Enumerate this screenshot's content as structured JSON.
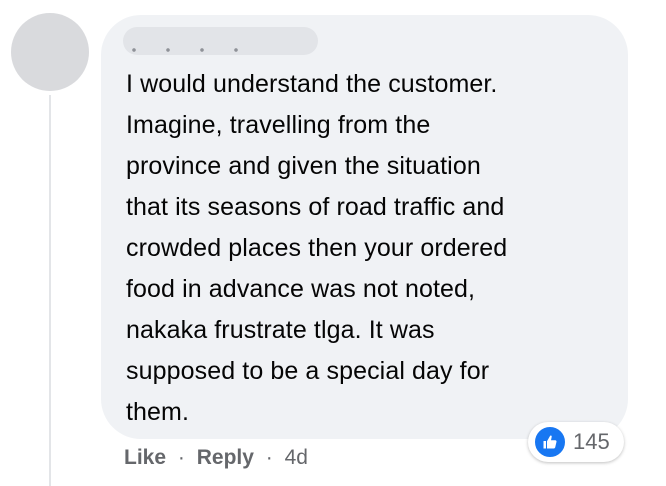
{
  "comment": {
    "author_redacted": true,
    "text_lines": [
      "I would understand the customer.",
      "Imagine, travelling from the",
      "province and given the situation",
      "that its seasons of road traffic and",
      "crowded places then your ordered",
      "food in advance was not noted,",
      "nakaka frustrate tlga. It was",
      "supposed to be a special day for",
      "them."
    ]
  },
  "actions": {
    "like_label": "Like",
    "separator": "·",
    "reply_label": "Reply",
    "timestamp": "4d"
  },
  "reactions": {
    "icon": "thumbs-up-icon",
    "count": "145",
    "color": "#1877f2"
  }
}
